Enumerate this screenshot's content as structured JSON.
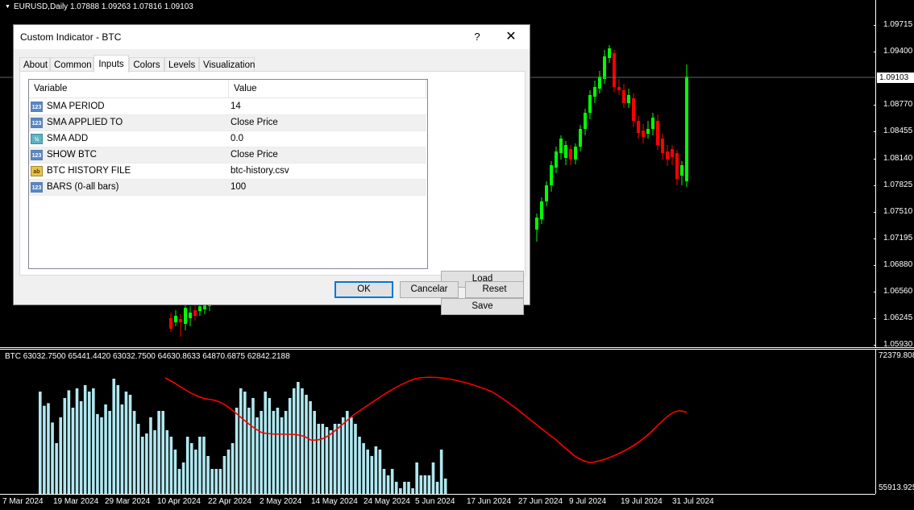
{
  "chart": {
    "symbol_line": "EURUSD,Daily  1.07888 1.09263 1.07816 1.09103",
    "price_labels": [
      "1.09715",
      "1.09400",
      "1.09103",
      "1.08770",
      "1.08455",
      "1.08140",
      "1.07825",
      "1.07510",
      "1.07195",
      "1.06880",
      "1.06560",
      "1.06245",
      "1.05930"
    ],
    "current_price": "1.09103",
    "indicator_line": "BTC 63032.7500 65441.4420 63032.7500 64630.8633 64870.6875 62842.2188",
    "indicator_labels": [
      "72379.808",
      "55913.925"
    ],
    "time_labels": [
      "7 Mar 2024",
      "19 Mar 2024",
      "29 Mar 2024",
      "10 Apr 2024",
      "22 Apr 2024",
      "2 May 2024",
      "14 May 2024",
      "24 May 2024",
      "5 Jun 2024",
      "17 Jun 2024",
      "27 Jun 2024",
      "9 Jul 2024",
      "19 Jul 2024",
      "31 Jul 2024"
    ],
    "colors": {
      "bull": "#00ff00",
      "bear": "#ff0000",
      "histogram": "#b0e8f0",
      "sma": "#ff0000",
      "background": "#000000"
    }
  },
  "dialog": {
    "title": "Custom Indicator - BTC",
    "help": "?",
    "close": "✕",
    "tabs": [
      {
        "label": "About"
      },
      {
        "label": "Common"
      },
      {
        "label": "Inputs"
      },
      {
        "label": "Colors"
      },
      {
        "label": "Levels"
      },
      {
        "label": "Visualization"
      }
    ],
    "active_tab": "Inputs",
    "grid": {
      "col_variable": "Variable",
      "col_value": "Value",
      "rows": [
        {
          "icon": "123",
          "variable": "SMA PERIOD",
          "value": "14"
        },
        {
          "icon": "123",
          "variable": "SMA APPLIED TO",
          "value": "Close Price"
        },
        {
          "icon": "½",
          "variable": "SMA ADD",
          "value": "0.0"
        },
        {
          "icon": "123",
          "variable": "SHOW BTC",
          "value": "Close Price"
        },
        {
          "icon": "ab",
          "variable": "BTC HISTORY FILE",
          "value": "btc-history.csv"
        },
        {
          "icon": "123",
          "variable": "BARS (0-all bars)",
          "value": "100"
        }
      ]
    },
    "buttons": {
      "load": "Load",
      "save": "Save",
      "ok": "OK",
      "cancel": "Cancelar",
      "reset": "Reset"
    }
  }
}
